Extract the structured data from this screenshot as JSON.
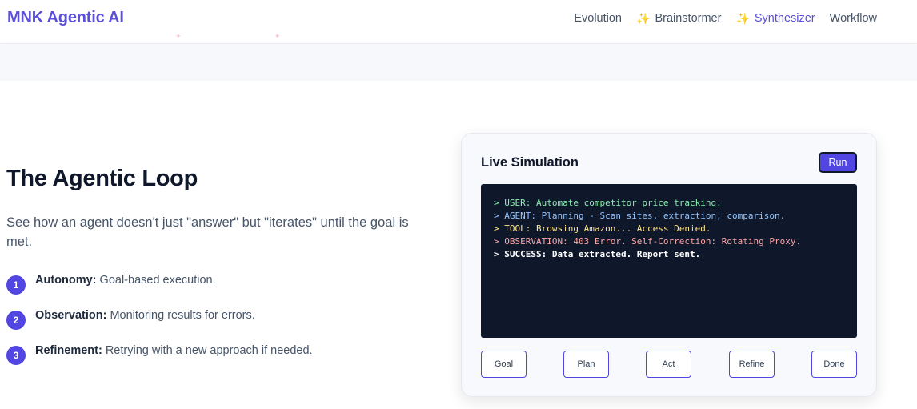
{
  "brand": "MNK Agentic AI",
  "nav": [
    {
      "label": "Evolution",
      "icon": "",
      "active": false
    },
    {
      "label": "Brainstormer",
      "icon": "sparkle-icon",
      "active": false
    },
    {
      "label": "Synthesizer",
      "icon": "sparkle-icon",
      "active": true
    },
    {
      "label": "Workflow",
      "icon": "",
      "active": false
    }
  ],
  "hero": {
    "title": "The Agentic Loop",
    "description": "See how an agent doesn't just \"answer\" but \"iterates\" until the goal is met."
  },
  "steps": [
    {
      "num": "1",
      "label": "Autonomy:",
      "text": "Goal-based execution."
    },
    {
      "num": "2",
      "label": "Observation:",
      "text": "Monitoring results for errors."
    },
    {
      "num": "3",
      "label": "Refinement:",
      "text": "Retrying with a new approach if needed."
    }
  ],
  "simulation": {
    "title": "Live Simulation",
    "run_label": "Run",
    "log": [
      {
        "text": "> USER: Automate competitor price tracking.",
        "tone": "green"
      },
      {
        "text": "> AGENT: Planning - Scan sites, extraction, comparison.",
        "tone": "blue"
      },
      {
        "text": "> TOOL: Browsing Amazon... Access Denied.",
        "tone": "yellow"
      },
      {
        "text": "> OBSERVATION: 403 Error. Self-Correction: Rotating Proxy.",
        "tone": "red"
      },
      {
        "text": "> SUCCESS: Data extracted. Report sent.",
        "tone": "white"
      }
    ],
    "stages": [
      "Goal",
      "Plan",
      "Act",
      "Refine",
      "Done"
    ]
  },
  "colors": {
    "accent": "#5146e1",
    "brand": "#5b4fd8",
    "terminal_bg": "#0f172a"
  }
}
